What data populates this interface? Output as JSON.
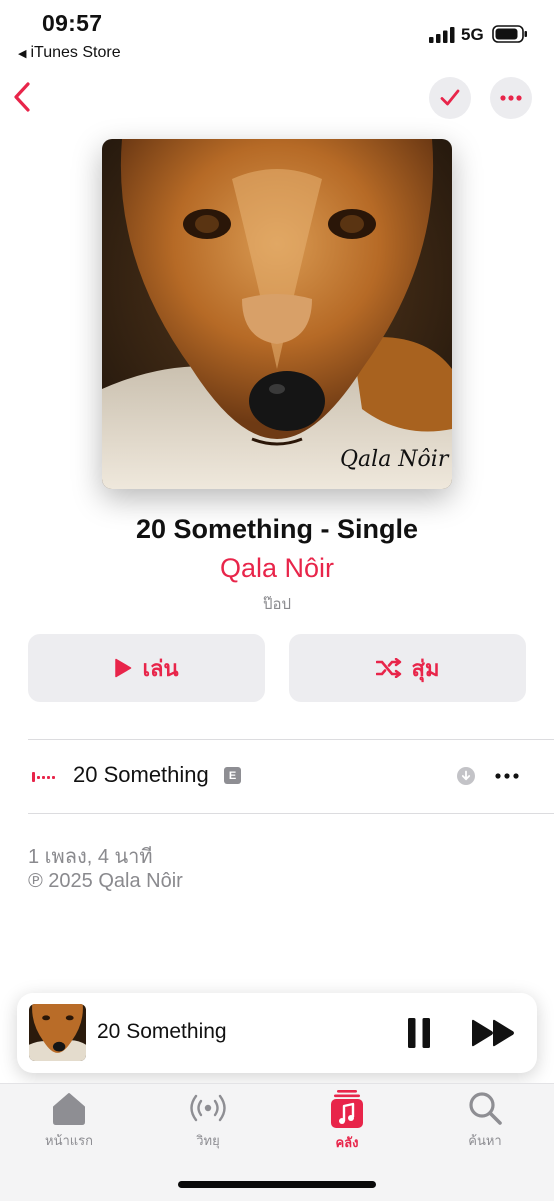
{
  "status_bar": {
    "time": "09:57",
    "back_app": "iTunes Store",
    "network": "5G"
  },
  "album": {
    "title": "20 Something - Single",
    "artist": "Qala Nôir",
    "genre": "ป๊อป",
    "artwork_signature": "Qala Nôir"
  },
  "actions": {
    "play_label": "เล่น",
    "shuffle_label": "สุ่ม"
  },
  "tracks": [
    {
      "title": "20 Something",
      "explicit_badge": "E"
    }
  ],
  "footer": {
    "summary": "1 เพลง, 4 นาที",
    "copyright": "℗ 2025 Qala Nôir"
  },
  "mini_player": {
    "title": "20 Something"
  },
  "tabs": [
    {
      "label": "หน้าแรก",
      "icon": "home-icon"
    },
    {
      "label": "วิทยุ",
      "icon": "radio-icon"
    },
    {
      "label": "คลัง",
      "icon": "library-icon",
      "active": true
    },
    {
      "label": "ค้นหา",
      "icon": "search-icon"
    }
  ],
  "colors": {
    "accent": "#e8254a",
    "secondary_text": "#8a8a8e",
    "button_bg": "#ededf0"
  }
}
